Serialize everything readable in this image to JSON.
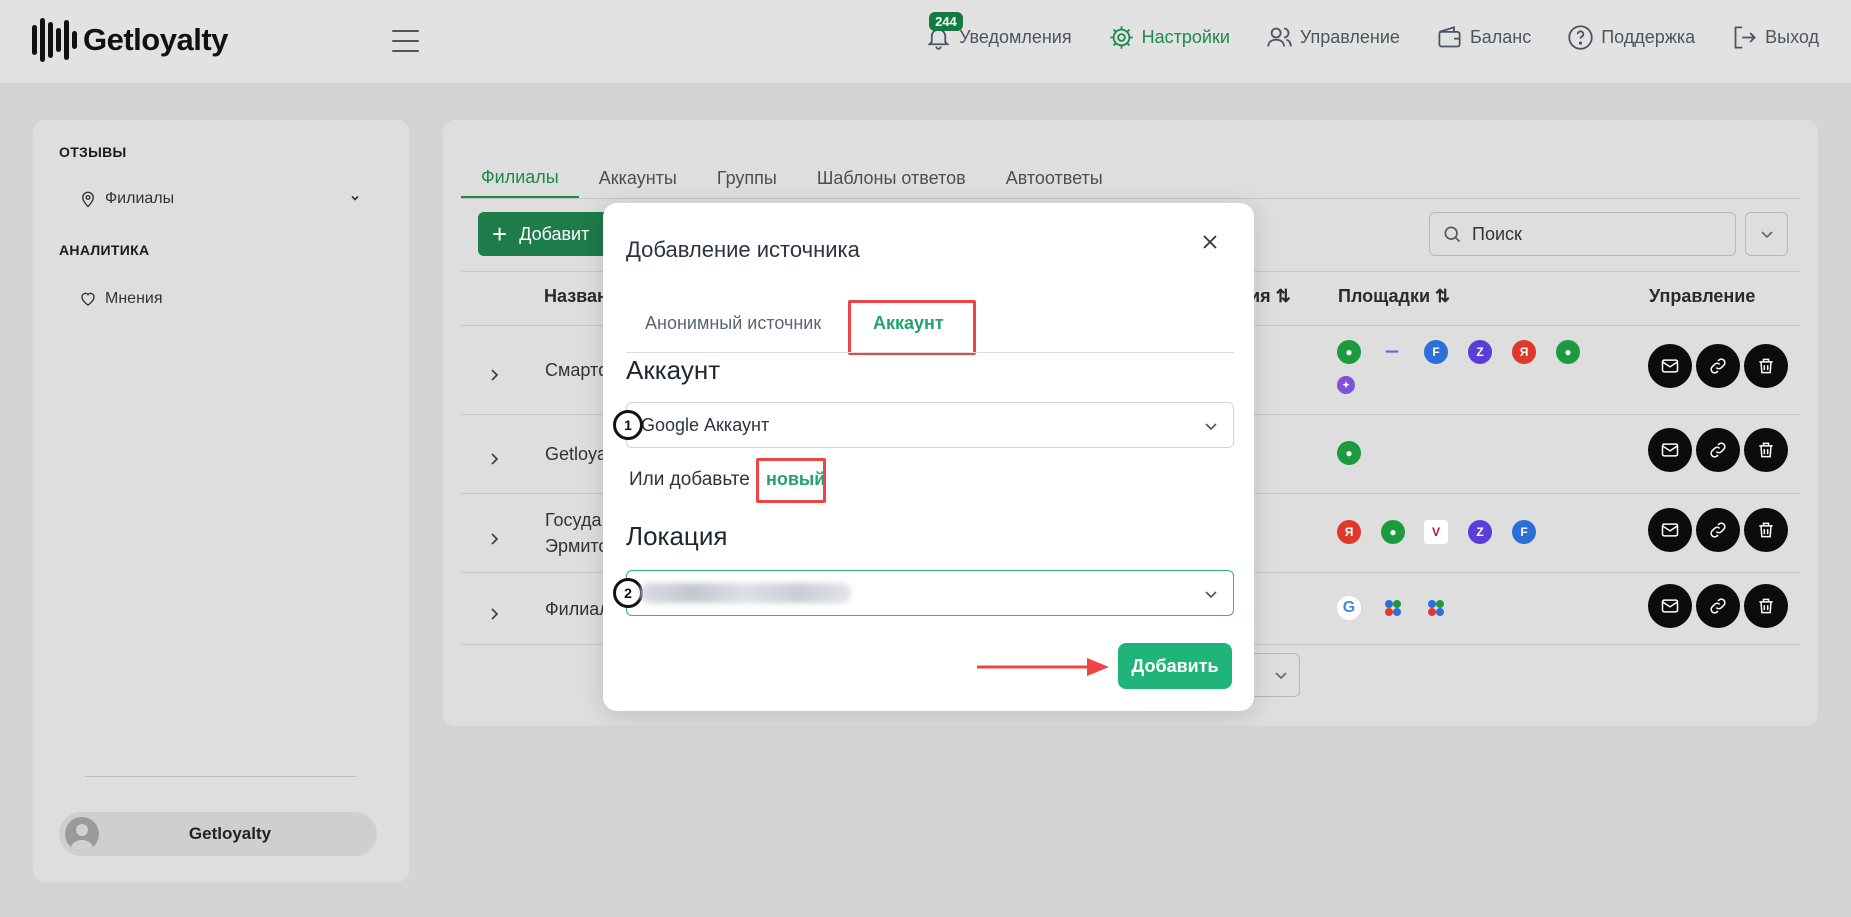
{
  "brand": {
    "name": "Getloyalty"
  },
  "topnav": {
    "notifications": {
      "label": "Уведомления",
      "badge": "244"
    },
    "settings": {
      "label": "Настройки"
    },
    "management": {
      "label": "Управление"
    },
    "balance": {
      "label": "Баланс"
    },
    "support": {
      "label": "Поддержка"
    },
    "logout": {
      "label": "Выход"
    }
  },
  "sidebar": {
    "section_reviews": "ОТЗЫВЫ",
    "item_branches": "Филиалы",
    "section_analytics": "АНАЛИТИКА",
    "item_opinions": "Мнения",
    "user_name": "Getloyalty"
  },
  "main": {
    "tabs": [
      "Филиалы",
      "Аккаунты",
      "Группы",
      "Шаблоны ответов",
      "Автоответы"
    ],
    "add_button": "Добавит",
    "search_placeholder": "Поиск",
    "headers": {
      "name": "Назван",
      "third": "ия ⇅",
      "platforms": "Площадки ⇅",
      "actions": "Управление"
    },
    "rows": [
      {
        "name": "Смартф"
      },
      {
        "name": "Getloyal"
      },
      {
        "name": "Госуда",
        "name2": "Эрмито"
      },
      {
        "name": "Филиал"
      }
    ]
  },
  "modal": {
    "title": "Добавление источника",
    "tabs": [
      "Анонимный источник",
      "Аккаунт"
    ],
    "account_section": "Аккаунт",
    "account_value": "Google Аккаунт",
    "or_text": "Или добавьте",
    "new_link": "новый",
    "location_section": "Локация",
    "submit": "Добавить",
    "step1": "1",
    "step2": "2"
  },
  "colors": {
    "accent": "#21a36a",
    "annotation": "#ef4444",
    "dark_button": "#0c0c0c"
  }
}
